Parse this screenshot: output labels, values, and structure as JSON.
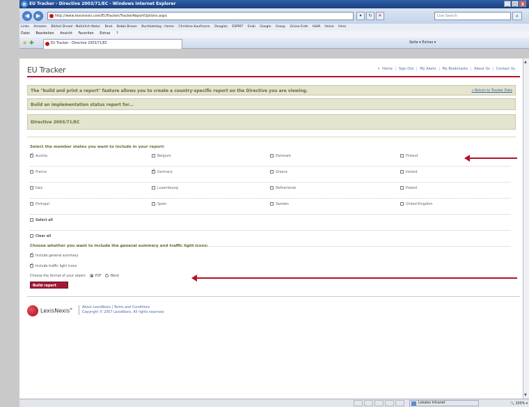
{
  "window": {
    "title": "EU Tracker - Directive 2003/71/EC - Windows Internet Explorer",
    "min_label": "_",
    "max_label": "□",
    "close_label": "X"
  },
  "addressbar": {
    "url": "http://www.lexisnexis.com/EUTracker/TrackerReportOptions.aspx",
    "search_placeholder": "Live Search"
  },
  "links_bar": {
    "items": [
      "Links",
      "Amazon",
      "Bärbel Drexel - Natürlich Natur",
      "Bnet",
      "Bobbi Brown",
      "Buchkatalog - Home",
      "Christine Kaufmann",
      "Douglas",
      "ESPRIT",
      "Evibi",
      "Google",
      "Group",
      "Grüne Erde",
      "H&M",
      "Heine",
      "Hess"
    ]
  },
  "menu": {
    "items": [
      "Datei",
      "Bearbeiten",
      "Ansicht",
      "Favoriten",
      "Extras",
      "?"
    ]
  },
  "tab": {
    "title": "EU Tracker - Directive 2003/71/EC"
  },
  "toolbar": {
    "tools": "Seite ▾   Extras ▾"
  },
  "site": {
    "logo": "EU Tracker",
    "nav": [
      "Home",
      "Sign Out",
      "My Alerts",
      "My Bookmarks",
      "About Us",
      "Contact Us"
    ]
  },
  "banner": {
    "info": "The \"build and print a report\" feature allows you to create a country-specific report on the Directive you are viewing.",
    "return_link": "» Return to Tracker Data",
    "build_heading": "Build an implementation status report for...",
    "directive": "Directive 2003/71/EC"
  },
  "states": {
    "title": "Select the member states you want to include in your report:",
    "rows": [
      [
        {
          "name": "Austria",
          "checked": true
        },
        {
          "name": "Belgium",
          "checked": false
        },
        {
          "name": "Denmark",
          "checked": false
        },
        {
          "name": "Finland",
          "checked": false
        }
      ],
      [
        {
          "name": "France",
          "checked": false
        },
        {
          "name": "Germany",
          "checked": true
        },
        {
          "name": "Greece",
          "checked": false
        },
        {
          "name": "Ireland",
          "checked": false
        }
      ],
      [
        {
          "name": "Italy",
          "checked": false
        },
        {
          "name": "Luxembourg",
          "checked": false
        },
        {
          "name": "Netherlands",
          "checked": false
        },
        {
          "name": "Poland",
          "checked": false
        }
      ],
      [
        {
          "name": "Portugal",
          "checked": false
        },
        {
          "name": "Spain",
          "checked": false
        },
        {
          "name": "Sweden",
          "checked": false
        },
        {
          "name": "United Kingdom",
          "checked": false
        }
      ]
    ],
    "select_all": "Select all",
    "clear_all": "Clear all"
  },
  "options": {
    "title": "Choose whether you want to include the general summary and traffic light icons:",
    "summary_label": "Include general summary",
    "traffic_label": "Include traffic light icons",
    "format_label": "Choose the format of your report:",
    "pdf_label": "PDF",
    "word_label": "Word",
    "selected_format": "PDF",
    "build_button": "Build report"
  },
  "footer": {
    "brand": "LexisNexis",
    "links": "About LexisNexis | Terms and Conditions",
    "copyright": "Copyright © 2007 LexisNexis. All rights reserved"
  },
  "status": {
    "zone": "Lokales Intranet",
    "zoom": "100%"
  },
  "colors": {
    "accent": "#b1122a",
    "banner": "#e5e4cf",
    "ie_title": "#1c3f7d"
  }
}
